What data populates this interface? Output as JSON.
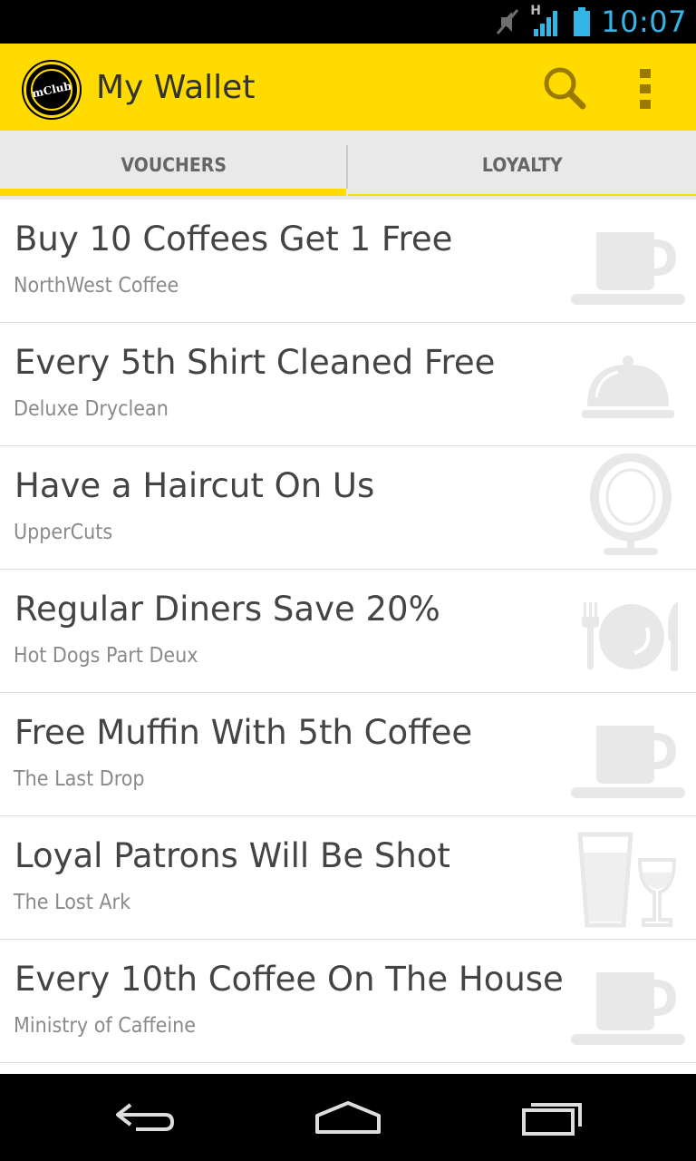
{
  "status_bar": {
    "time": "10:07",
    "network_label": "H",
    "icons": [
      "muted-icon",
      "signal-icon",
      "battery-icon"
    ]
  },
  "action_bar": {
    "logo_text": "mClub",
    "title": "My Wallet",
    "accent_color": "#ffdb00",
    "icons": [
      "search-icon",
      "overflow-menu-icon"
    ]
  },
  "tabs": [
    {
      "label": "VOUCHERS",
      "selected": true
    },
    {
      "label": "LOYALTY",
      "selected": false
    }
  ],
  "vouchers": [
    {
      "title": "Buy 10 Coffees Get 1 Free",
      "merchant": "NorthWest Coffee",
      "icon": "coffee-cup-icon"
    },
    {
      "title": "Every 5th Shirt Cleaned Free",
      "merchant": "Deluxe Dryclean",
      "icon": "cloche-icon"
    },
    {
      "title": "Have a Haircut On Us",
      "merchant": "UpperCuts",
      "icon": "mirror-icon"
    },
    {
      "title": "Regular Diners Save 20%",
      "merchant": "Hot Dogs Part Deux",
      "icon": "plate-cutlery-icon"
    },
    {
      "title": "Free Muffin With 5th Coffee",
      "merchant": "The Last Drop",
      "icon": "coffee-cup-icon"
    },
    {
      "title": "Loyal Patrons Will Be Shot",
      "merchant": "The Lost Ark",
      "icon": "drinks-icon"
    },
    {
      "title": "Every 10th Coffee On The House",
      "merchant": "Ministry of Caffeine",
      "icon": "coffee-cup-icon"
    }
  ],
  "nav_bar": {
    "icons": [
      "back-icon",
      "home-icon",
      "recent-apps-icon"
    ]
  }
}
